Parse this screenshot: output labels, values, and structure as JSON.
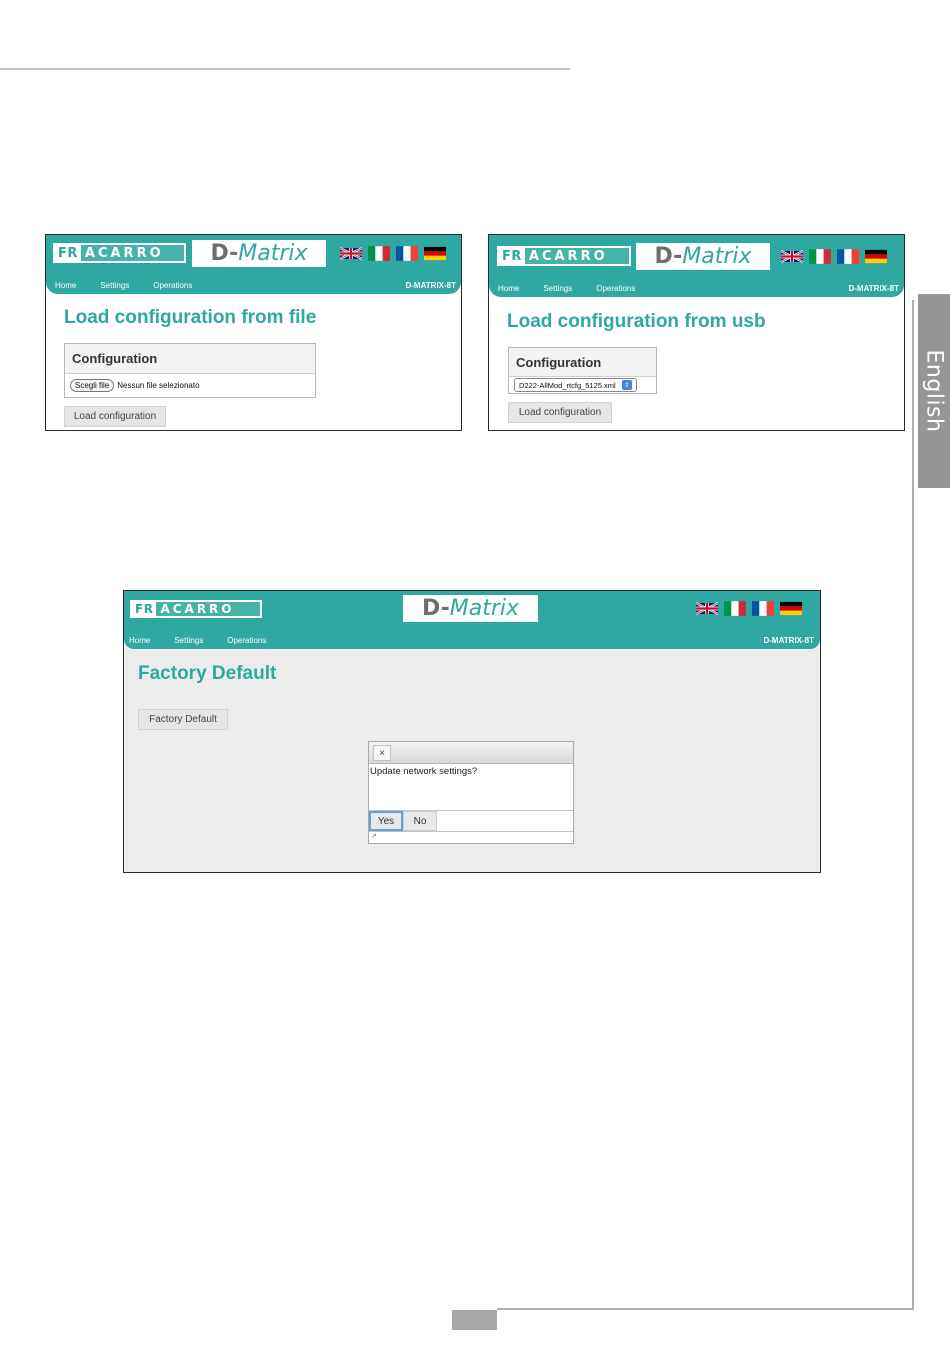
{
  "sidebar": {
    "language_tab": "English"
  },
  "screens": [
    {
      "brand": {
        "fr": "FR",
        "rest": "ACARRO"
      },
      "product": {
        "prefix": "D-",
        "name": "Matrix"
      },
      "nav": [
        "Home",
        "Settings",
        "Operations"
      ],
      "model": "D-MATRIX-8T",
      "title": "Load configuration from file",
      "panel_title": "Configuration",
      "file_button": "Scegli file",
      "file_status": "Nessun file selezionato",
      "action_button": "Load configuration"
    },
    {
      "brand": {
        "fr": "FR",
        "rest": "ACARRO"
      },
      "product": {
        "prefix": "D-",
        "name": "Matrix"
      },
      "nav": [
        "Home",
        "Settings",
        "Operations"
      ],
      "model": "D-MATRIX-8T",
      "title": "Load configuration from usb",
      "panel_title": "Configuration",
      "selected_file": "D222-AllMod_rtcfg_5125.xml",
      "action_button": "Load configuration"
    },
    {
      "brand": {
        "fr": "FR",
        "rest": "ACARRO"
      },
      "product": {
        "prefix": "D-",
        "name": "Matrix"
      },
      "nav": [
        "Home",
        "Settings",
        "Operations"
      ],
      "model": "D-MATRIX-8T",
      "title": "Factory Default",
      "action_button": "Factory Default",
      "dialog": {
        "close": "×",
        "message": "Update network settings?",
        "yes": "Yes",
        "no": "No",
        "resize": "⇗"
      }
    }
  ],
  "colors": {
    "header_teal": "#2ea8a0",
    "title_teal": "#2ea8a0",
    "tab_gray": "#969696"
  },
  "flags": [
    "uk-flag-icon",
    "italy-flag-icon",
    "france-flag-icon",
    "germany-flag-icon"
  ]
}
